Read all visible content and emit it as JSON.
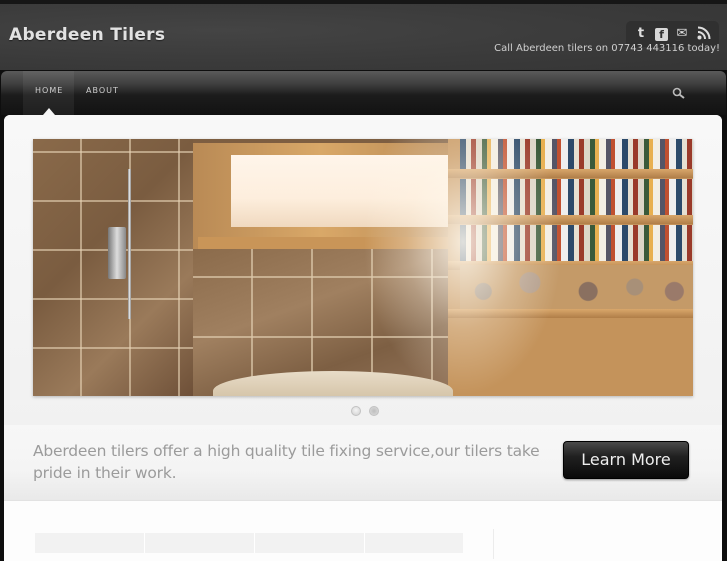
{
  "header": {
    "site_title": "Aberdeen Tilers",
    "tagline": "Call Aberdeen tilers on 07743 443116 today!",
    "social_icons": [
      {
        "name": "twitter-icon",
        "glyph": "t"
      },
      {
        "name": "facebook-icon",
        "glyph": "f"
      },
      {
        "name": "email-icon",
        "glyph": "✉"
      },
      {
        "name": "rss-icon",
        "glyph": "◜"
      }
    ]
  },
  "nav": {
    "items": [
      {
        "label": "HOME",
        "active": true
      },
      {
        "label": "ABOUT",
        "active": false
      }
    ],
    "search_icon": "search-icon"
  },
  "slider": {
    "slide_count": 2,
    "active_slide": 2,
    "image_description": "Tiled bathroom with shower, window and bookshelf"
  },
  "intro": {
    "text": "Aberdeen tilers offer a high quality tile fixing service,our tilers take pride in their work.",
    "button_label": "Learn More"
  },
  "content": {
    "tabs": [
      "",
      "",
      "",
      ""
    ]
  }
}
